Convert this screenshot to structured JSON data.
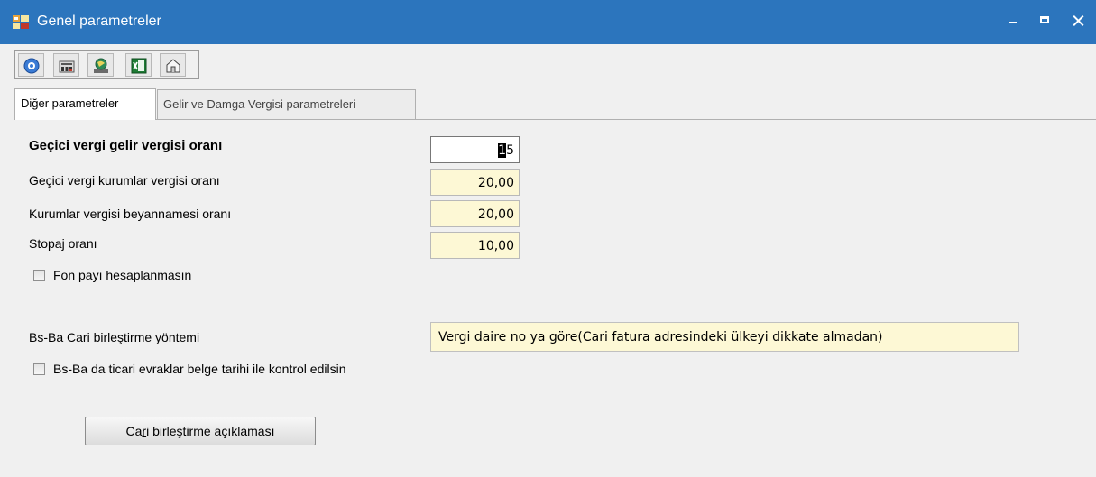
{
  "window": {
    "title": "Genel parametreler",
    "controls": {
      "minimize": "minimize",
      "maximize": "maximize",
      "close": "close"
    }
  },
  "toolbar": {
    "buttons": [
      {
        "icon": "help-icon"
      },
      {
        "icon": "calculator-icon"
      },
      {
        "icon": "globe-icon"
      },
      {
        "icon": "excel-icon"
      },
      {
        "icon": "exit-icon"
      }
    ]
  },
  "tabs": [
    {
      "label": "Diğer parametreler",
      "active": true
    },
    {
      "label": "Gelir ve Damga Vergisi parametreleri",
      "active": false
    }
  ],
  "fields": {
    "gecici_gelir": {
      "label": "Geçici vergi gelir vergisi oranı",
      "value_selected": "1",
      "value_rest": "5"
    },
    "gecici_kurumlar": {
      "label": "Geçici vergi kurumlar vergisi oranı",
      "value": "20,00"
    },
    "kurumlar_beyanname": {
      "label": "Kurumlar vergisi beyannamesi oranı",
      "value": "20,00"
    },
    "stopaj": {
      "label": "Stopaj oranı",
      "value": "10,00"
    },
    "fon_payi": {
      "label": "Fon payı hesaplanmasın",
      "checked": false
    },
    "bsba_yontem": {
      "label": "Bs-Ba Cari birleştirme yöntemi",
      "value": "Vergi daire no ya göre(Cari fatura adresindeki ülkeyi dikkate almadan)"
    },
    "bsba_kontrol": {
      "label": "Bs-Ba da ticari evraklar belge tarihi ile kontrol edilsin",
      "checked": false
    }
  },
  "button": {
    "prefix": "Ca",
    "accel": "r",
    "suffix": "i birleştirme açıklaması"
  },
  "colors": {
    "titlebar": "#2c75bd",
    "field_bg": "#fdf8d5",
    "panel_bg": "#f0f0f0"
  }
}
